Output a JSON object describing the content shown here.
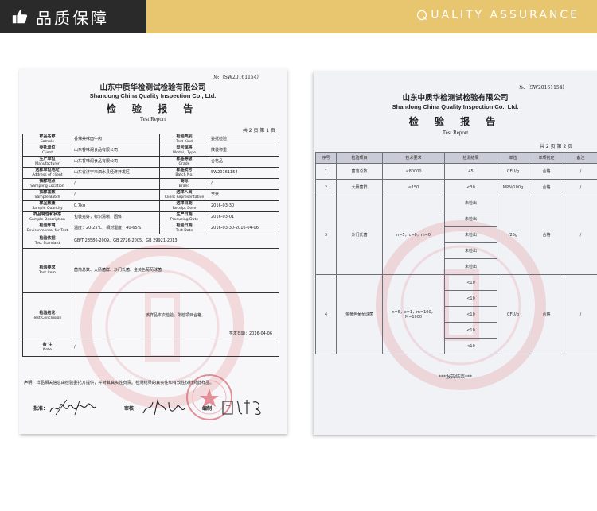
{
  "banner": {
    "title": "品质保障",
    "subtitle": "UALITY ASSURANCE",
    "colors": {
      "gold": "#e7c66f",
      "dark": "#2a2a2a"
    },
    "icons": [
      "thumbs-up-icon",
      "crescent-q-icon"
    ]
  },
  "page1": {
    "report_no": "№:（SW20161154）",
    "company_cn": "山东中质华检测试检验有限公司",
    "company_en": "Shandong China Quality Inspection Co., Ltd.",
    "title_cn": "检  验  报  告",
    "title_en": "Test    Report",
    "page_label": "共 2 页  第 1 页",
    "rows": {
      "sample": {
        "label_cn": "样品名称",
        "label_en": "Sample",
        "value": "香辣美味卤牛肉",
        "label2_cn": "检验类别",
        "label2_en": "Test Kind",
        "value2": "委托检验"
      },
      "client": {
        "label_cn": "委托单位",
        "label_en": "Client",
        "value": "山东香味阁食品有限公司",
        "label2_cn": "型号规格",
        "label2_en": "Model，Type",
        "value2": "散装称重"
      },
      "manufacturer": {
        "label_cn": "生产单位",
        "label_en": "Manufacturer",
        "value": "山东香味阁食品有限公司",
        "label2_cn": "样品等级",
        "label2_en": "Grade",
        "value2": "合格品"
      },
      "address": {
        "label_cn": "送样单位地址",
        "label_en": "Address of client",
        "value": "山东省济宁市泗水县经济开发区",
        "label2_cn": "样品批号",
        "label2_en": "Batch  No.",
        "value2": "SW20161154"
      },
      "location": {
        "label_cn": "抽样地点",
        "label_en": "Sampling Location",
        "value": "/",
        "label2_cn": "商标",
        "label2_en": "Brand",
        "value2": "/"
      },
      "batch": {
        "label_cn": "抽样基数",
        "label_en": "Sample Batch",
        "value": "/",
        "label2_cn": "送样人员",
        "label2_en": "Client Representative",
        "value2": "李景"
      },
      "quantity": {
        "label_cn": "样品数量",
        "label_en": "Sample Quantity",
        "value": "0.7kg",
        "label2_cn": "送样日期",
        "label2_en": "Receipt Date",
        "value2": "2016-03-30"
      },
      "description": {
        "label_cn": "样品特性和状态",
        "label_en": "Sample Description",
        "value": "包装完好，标识清晰，固体",
        "label2_cn": "生产日期",
        "label2_en": "Producing Date",
        "value2": "2016-03-01"
      },
      "environment": {
        "label_cn": "检验环境",
        "label_en": "Environmental for Test",
        "value": "温度：20-25℃，相对湿度：40-65%",
        "label2_cn": "检验日期",
        "label2_en": "Test Date",
        "value2": "2016-03-30-2016-04-06"
      },
      "standard": {
        "label_cn": "检验依据",
        "label_en": "Test Standard",
        "value": "GB/T 23586-2009、GB 2726-2005、GB 29921-2013"
      },
      "item": {
        "label_cn": "检验要求",
        "label_en": "Test Item",
        "value": "菌落总数、大肠菌群、沙门氏菌、金黄色葡萄球菌"
      },
      "conclusion": {
        "label_cn": "检验结论",
        "label_en": "Test Conclusion",
        "value": "该样品本次检验，所检项目合格。",
        "date": "签发日期：2016-04-06"
      },
      "note": {
        "label_cn": "备  注",
        "label_en": "Note",
        "value": "/"
      }
    },
    "statement": "声明：样品相关信息由检验委托方提供，并对其真实性负责。检测结果的真实性和有效性仅针对此样品。",
    "signatures": {
      "approve_label": "批准：",
      "review_label": "审核：",
      "compile_label": "编制："
    }
  },
  "page2": {
    "report_no": "№:（SW20161154）",
    "company_cn": "山东中质华检测试检验有限公司",
    "company_en": "Shandong China Quality Inspection Co., Ltd.",
    "title_cn": "检  验  报  告",
    "title_en": "Test    Report",
    "page_label": "共 2 页  第 2 页",
    "headers": [
      "序号",
      "检验项目",
      "技术要求",
      "检测结果",
      "单位",
      "单项判定",
      "备注"
    ],
    "rows": [
      {
        "no": "1",
        "item": "菌落总数",
        "req": "≤80000",
        "results": [
          "45"
        ],
        "unit": "CFU/g",
        "judge": "合格",
        "note": "/"
      },
      {
        "no": "2",
        "item": "大肠菌群",
        "req": "≤150",
        "results": [
          "<30"
        ],
        "unit": "MPN/100g",
        "judge": "合格",
        "note": "/"
      },
      {
        "no": "3",
        "item": "沙门氏菌",
        "req": "n=5，c=0，m=0",
        "results": [
          "未检出",
          "未检出",
          "未检出",
          "未检出",
          "未检出"
        ],
        "unit": "/25g",
        "judge": "合格",
        "note": "/"
      },
      {
        "no": "4",
        "item": "金黄色葡萄球菌",
        "req": "n=5，c=1，m=100，M=1000",
        "results": [
          "<10",
          "<10",
          "<10",
          "<10",
          "<10"
        ],
        "unit": "CFU/g",
        "judge": "合格",
        "note": "/"
      }
    ],
    "end_note": "***报告结束***"
  }
}
